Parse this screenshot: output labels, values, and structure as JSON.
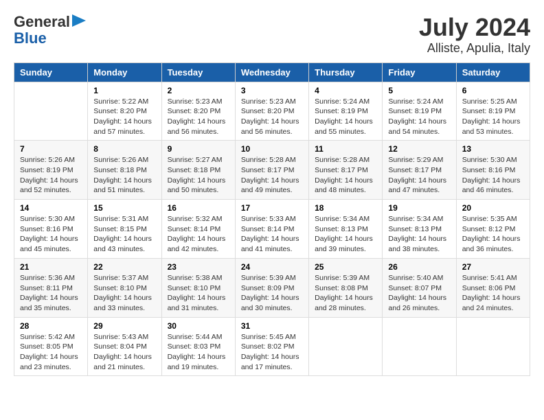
{
  "header": {
    "logo_line1": "General",
    "logo_line2": "Blue",
    "title": "July 2024",
    "subtitle": "Alliste, Apulia, Italy"
  },
  "days_of_week": [
    "Sunday",
    "Monday",
    "Tuesday",
    "Wednesday",
    "Thursday",
    "Friday",
    "Saturday"
  ],
  "weeks": [
    [
      {
        "day": "",
        "info": ""
      },
      {
        "day": "1",
        "info": "Sunrise: 5:22 AM\nSunset: 8:20 PM\nDaylight: 14 hours\nand 57 minutes."
      },
      {
        "day": "2",
        "info": "Sunrise: 5:23 AM\nSunset: 8:20 PM\nDaylight: 14 hours\nand 56 minutes."
      },
      {
        "day": "3",
        "info": "Sunrise: 5:23 AM\nSunset: 8:20 PM\nDaylight: 14 hours\nand 56 minutes."
      },
      {
        "day": "4",
        "info": "Sunrise: 5:24 AM\nSunset: 8:19 PM\nDaylight: 14 hours\nand 55 minutes."
      },
      {
        "day": "5",
        "info": "Sunrise: 5:24 AM\nSunset: 8:19 PM\nDaylight: 14 hours\nand 54 minutes."
      },
      {
        "day": "6",
        "info": "Sunrise: 5:25 AM\nSunset: 8:19 PM\nDaylight: 14 hours\nand 53 minutes."
      }
    ],
    [
      {
        "day": "7",
        "info": "Sunrise: 5:26 AM\nSunset: 8:19 PM\nDaylight: 14 hours\nand 52 minutes."
      },
      {
        "day": "8",
        "info": "Sunrise: 5:26 AM\nSunset: 8:18 PM\nDaylight: 14 hours\nand 51 minutes."
      },
      {
        "day": "9",
        "info": "Sunrise: 5:27 AM\nSunset: 8:18 PM\nDaylight: 14 hours\nand 50 minutes."
      },
      {
        "day": "10",
        "info": "Sunrise: 5:28 AM\nSunset: 8:17 PM\nDaylight: 14 hours\nand 49 minutes."
      },
      {
        "day": "11",
        "info": "Sunrise: 5:28 AM\nSunset: 8:17 PM\nDaylight: 14 hours\nand 48 minutes."
      },
      {
        "day": "12",
        "info": "Sunrise: 5:29 AM\nSunset: 8:17 PM\nDaylight: 14 hours\nand 47 minutes."
      },
      {
        "day": "13",
        "info": "Sunrise: 5:30 AM\nSunset: 8:16 PM\nDaylight: 14 hours\nand 46 minutes."
      }
    ],
    [
      {
        "day": "14",
        "info": "Sunrise: 5:30 AM\nSunset: 8:16 PM\nDaylight: 14 hours\nand 45 minutes."
      },
      {
        "day": "15",
        "info": "Sunrise: 5:31 AM\nSunset: 8:15 PM\nDaylight: 14 hours\nand 43 minutes."
      },
      {
        "day": "16",
        "info": "Sunrise: 5:32 AM\nSunset: 8:14 PM\nDaylight: 14 hours\nand 42 minutes."
      },
      {
        "day": "17",
        "info": "Sunrise: 5:33 AM\nSunset: 8:14 PM\nDaylight: 14 hours\nand 41 minutes."
      },
      {
        "day": "18",
        "info": "Sunrise: 5:34 AM\nSunset: 8:13 PM\nDaylight: 14 hours\nand 39 minutes."
      },
      {
        "day": "19",
        "info": "Sunrise: 5:34 AM\nSunset: 8:13 PM\nDaylight: 14 hours\nand 38 minutes."
      },
      {
        "day": "20",
        "info": "Sunrise: 5:35 AM\nSunset: 8:12 PM\nDaylight: 14 hours\nand 36 minutes."
      }
    ],
    [
      {
        "day": "21",
        "info": "Sunrise: 5:36 AM\nSunset: 8:11 PM\nDaylight: 14 hours\nand 35 minutes."
      },
      {
        "day": "22",
        "info": "Sunrise: 5:37 AM\nSunset: 8:10 PM\nDaylight: 14 hours\nand 33 minutes."
      },
      {
        "day": "23",
        "info": "Sunrise: 5:38 AM\nSunset: 8:10 PM\nDaylight: 14 hours\nand 31 minutes."
      },
      {
        "day": "24",
        "info": "Sunrise: 5:39 AM\nSunset: 8:09 PM\nDaylight: 14 hours\nand 30 minutes."
      },
      {
        "day": "25",
        "info": "Sunrise: 5:39 AM\nSunset: 8:08 PM\nDaylight: 14 hours\nand 28 minutes."
      },
      {
        "day": "26",
        "info": "Sunrise: 5:40 AM\nSunset: 8:07 PM\nDaylight: 14 hours\nand 26 minutes."
      },
      {
        "day": "27",
        "info": "Sunrise: 5:41 AM\nSunset: 8:06 PM\nDaylight: 14 hours\nand 24 minutes."
      }
    ],
    [
      {
        "day": "28",
        "info": "Sunrise: 5:42 AM\nSunset: 8:05 PM\nDaylight: 14 hours\nand 23 minutes."
      },
      {
        "day": "29",
        "info": "Sunrise: 5:43 AM\nSunset: 8:04 PM\nDaylight: 14 hours\nand 21 minutes."
      },
      {
        "day": "30",
        "info": "Sunrise: 5:44 AM\nSunset: 8:03 PM\nDaylight: 14 hours\nand 19 minutes."
      },
      {
        "day": "31",
        "info": "Sunrise: 5:45 AM\nSunset: 8:02 PM\nDaylight: 14 hours\nand 17 minutes."
      },
      {
        "day": "",
        "info": ""
      },
      {
        "day": "",
        "info": ""
      },
      {
        "day": "",
        "info": ""
      }
    ]
  ]
}
